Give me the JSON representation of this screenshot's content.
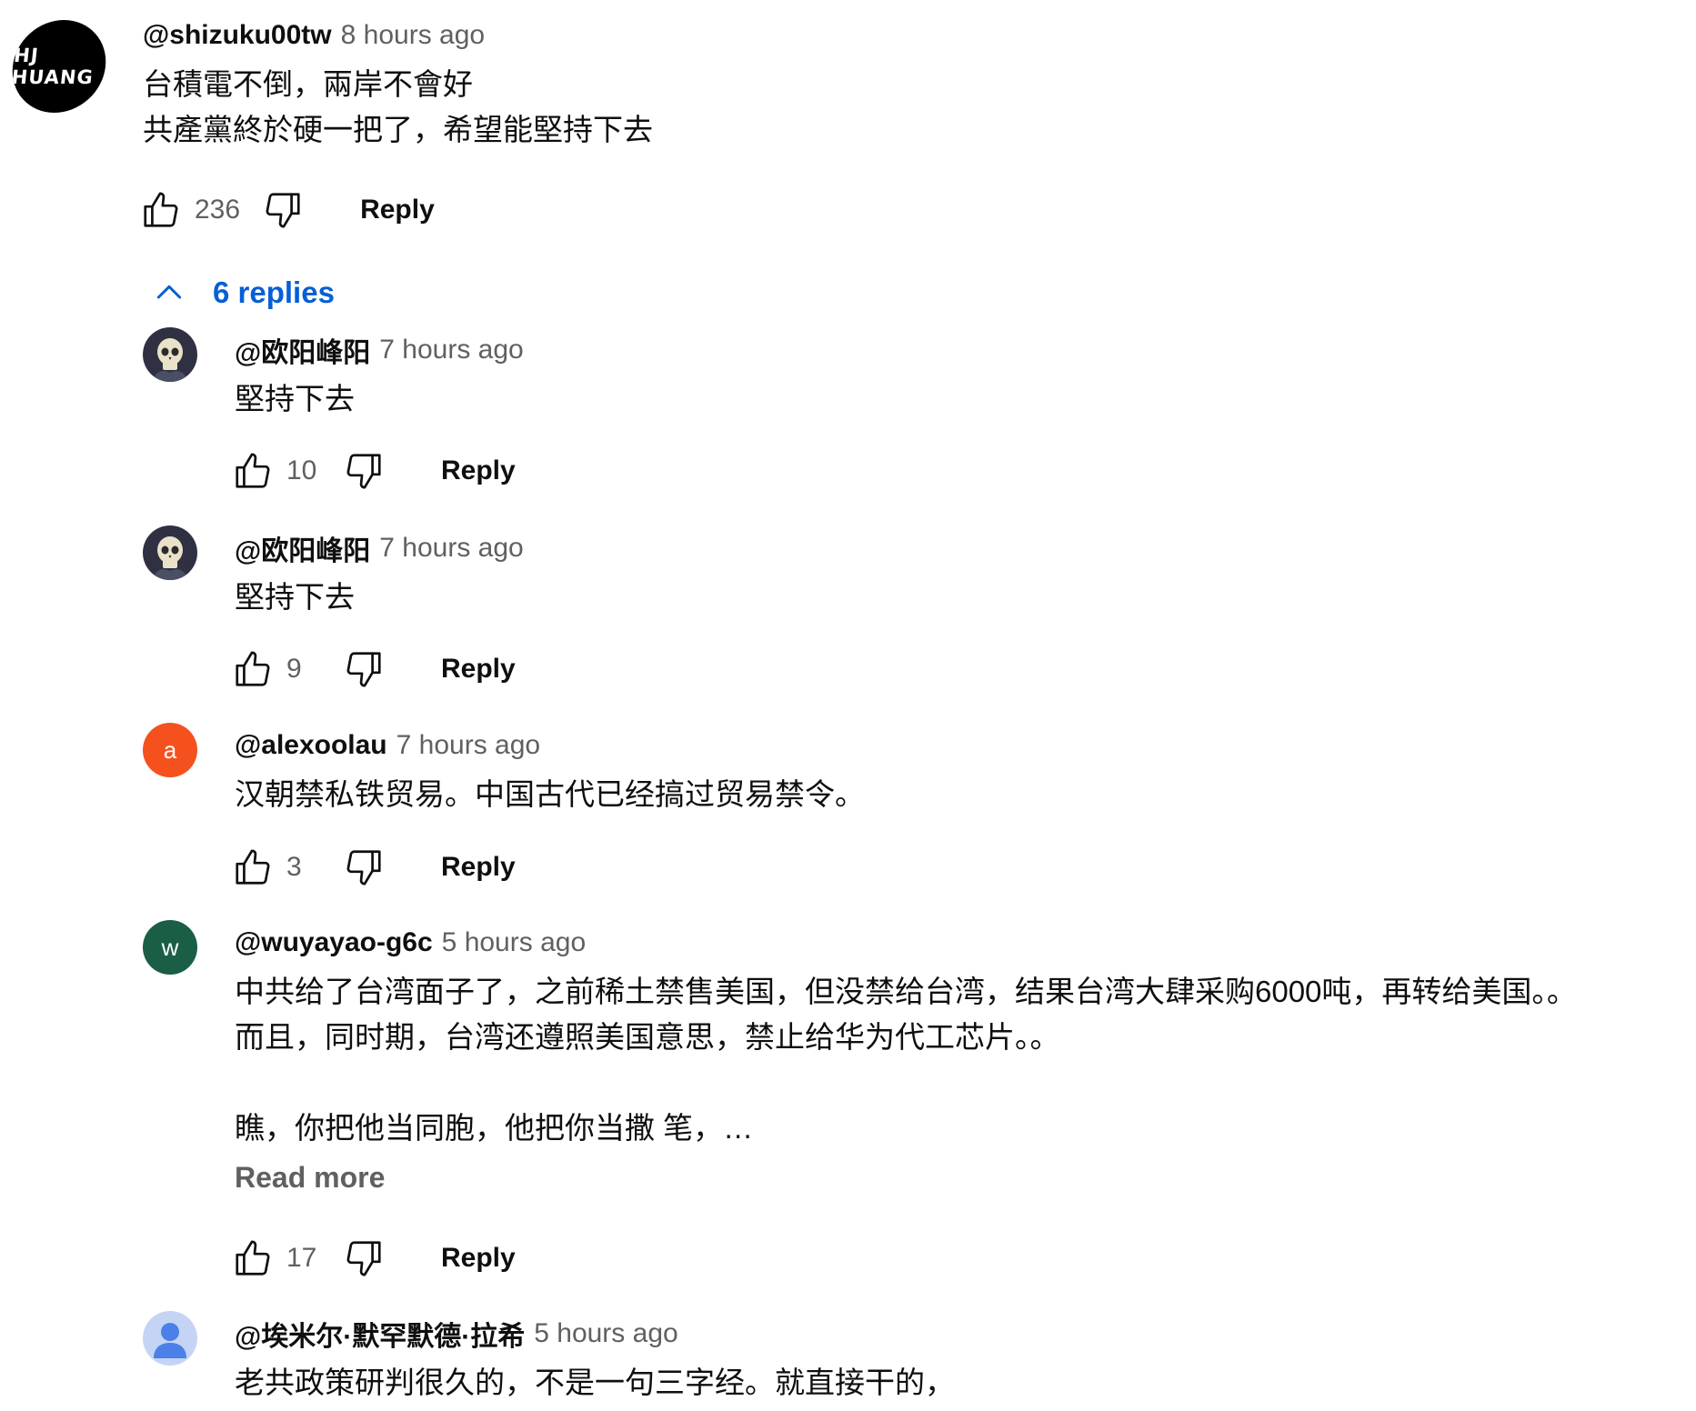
{
  "colors": {
    "link_blue": "#065fd4",
    "secondary_text": "#606060",
    "primary_text": "#0f0f0f",
    "avatar_orange": "#f4511e",
    "avatar_green": "#1b5e46",
    "avatar_generic": "#c5d4f5"
  },
  "top_comment": {
    "avatar_text": "HJ HUANG",
    "author": "@shizuku00tw",
    "time": "8 hours ago",
    "text": "台積電不倒，兩岸不會好\n共產黨終於硬一把了，希望能堅持下去",
    "likes": "236",
    "reply_label": "Reply",
    "icons": {
      "like": "thumb-up-icon",
      "dislike": "thumb-down-icon"
    }
  },
  "replies_toggle": {
    "label": "6 replies",
    "icon": "chevron-up-icon"
  },
  "replies": [
    {
      "avatar": "skull-avatar",
      "author": "@欧阳峰阳",
      "time": "7 hours ago",
      "text": "堅持下去",
      "likes": "10",
      "reply_label": "Reply"
    },
    {
      "avatar": "skull-avatar",
      "author": "@欧阳峰阳",
      "time": "7 hours ago",
      "text": "堅持下去",
      "likes": "9",
      "reply_label": "Reply"
    },
    {
      "avatar_letter": "a",
      "author": "@alexoolau",
      "time": "7 hours ago",
      "text": "汉朝禁私铁贸易。中国古代已经搞过贸易禁令。",
      "likes": "3",
      "reply_label": "Reply"
    },
    {
      "avatar_letter": "w",
      "author": "@wuyayao-g6c",
      "time": "5 hours ago",
      "text": "中共给了台湾面子了，之前稀土禁售美国，但没禁给台湾，结果台湾大肆采购6000吨，再转给美国。。\n而且，同时期，台湾还遵照美国意思，禁止给华为代工芯片。。\n\n瞧，你把他当同胞，他把你当撒 笔，…",
      "read_more": "Read more",
      "likes": "17",
      "reply_label": "Reply"
    },
    {
      "avatar": "person-avatar",
      "author": "@埃米尔·默罕默德·拉希",
      "time": "5 hours ago",
      "text": "老共政策研判很久的，不是一句三字经。就直接干的，"
    }
  ]
}
